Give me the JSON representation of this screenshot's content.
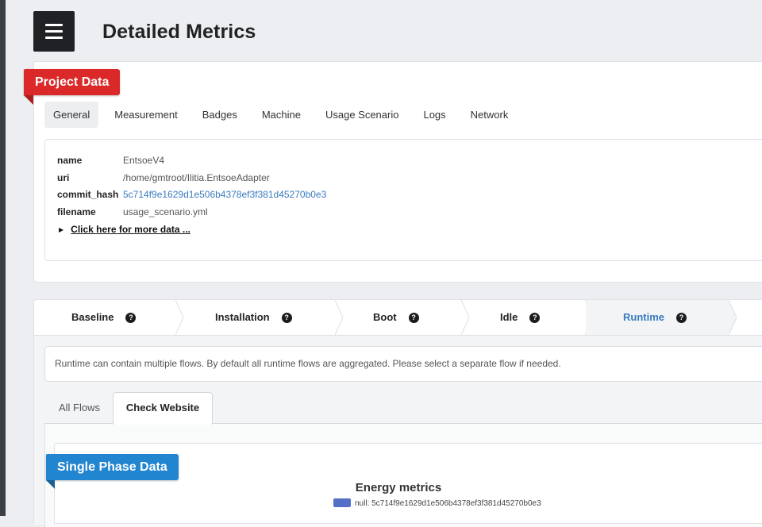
{
  "page": {
    "title": "Detailed Metrics"
  },
  "project": {
    "ribbon": "Project Data",
    "tabs": [
      {
        "label": "General",
        "active": true
      },
      {
        "label": "Measurement",
        "active": false
      },
      {
        "label": "Badges",
        "active": false
      },
      {
        "label": "Machine",
        "active": false
      },
      {
        "label": "Usage Scenario",
        "active": false
      },
      {
        "label": "Logs",
        "active": false
      },
      {
        "label": "Network",
        "active": false
      }
    ],
    "fields": [
      {
        "key": "name",
        "value": "EntsoeV4"
      },
      {
        "key": "uri",
        "value": "/home/gmtroot/Ilitia.EntsoeAdapter"
      },
      {
        "key": "commit_hash",
        "value": "5c714f9e1629d1e506b4378ef3f381d45270b0e3"
      },
      {
        "key": "filename",
        "value": "usage_scenario.yml"
      }
    ],
    "more_link": "Click here for more data ..."
  },
  "phases": {
    "steps": [
      {
        "label": "Baseline",
        "help": "?"
      },
      {
        "label": "Installation",
        "help": "?"
      },
      {
        "label": "Boot",
        "help": "?"
      },
      {
        "label": "Idle",
        "help": "?"
      },
      {
        "label": "Runtime",
        "help": "?",
        "active": true
      }
    ],
    "note": "Runtime can contain multiple flows. By default all runtime flows are aggregated. Please select a separate flow if needed.",
    "flow_tabs": [
      {
        "label": "All Flows",
        "active": false
      },
      {
        "label": "Check Website",
        "active": true
      }
    ]
  },
  "single_phase": {
    "ribbon": "Single Phase Data",
    "chart_title": "Energy metrics",
    "legend_label": "null: 5c714f9e1629d1e506b4378ef3f381d45270b0e3",
    "legend_color": "#5470c6"
  },
  "colors": {
    "ribbon_red": "#db2828",
    "ribbon_blue": "#2185d0",
    "link": "#3a7bbf",
    "menu_button": "#1f2124"
  },
  "icons": {
    "menu": "hamburger-menu-icon",
    "help": "question-circle-icon",
    "expand": "caret-right-icon"
  }
}
